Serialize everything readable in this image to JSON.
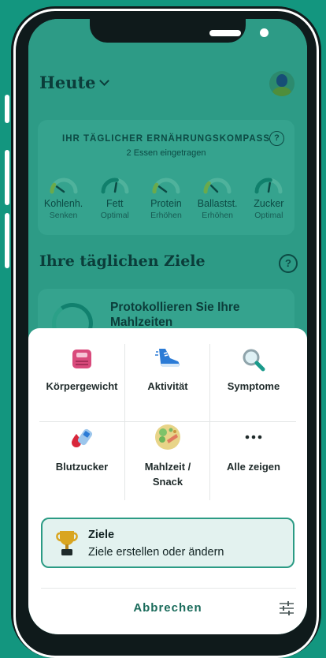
{
  "colors": {
    "accent": "#13967f",
    "dim_bg": "#2d9b86",
    "text_dark": "#0b3d3a"
  },
  "header": {
    "title": "Heute"
  },
  "compass": {
    "title": "IHR TÄGLICHER ERNÄHRUNGSKOMPASS",
    "subtitle": "2 Essen eingetragen",
    "gauges": [
      {
        "name": "Kohlenh.",
        "status": "Senken",
        "level": 0.2
      },
      {
        "name": "Fett",
        "status": "Optimal",
        "level": 0.55
      },
      {
        "name": "Protein",
        "status": "Erhöhen",
        "level": 0.2
      },
      {
        "name": "Ballastst.",
        "status": "Erhöhen",
        "level": 0.25
      },
      {
        "name": "Zucker",
        "status": "Optimal",
        "level": 0.55
      }
    ]
  },
  "goals": {
    "title": "Ihre täglichen Ziele",
    "card_text": "Protokollieren Sie Ihre Mahlzeiten"
  },
  "sheet": {
    "items": [
      {
        "label": "Körpergewicht",
        "icon": "scale-icon"
      },
      {
        "label": "Aktivität",
        "icon": "shoe-icon"
      },
      {
        "label": "Symptome",
        "icon": "magnifier-icon"
      },
      {
        "label": "Blutzucker",
        "icon": "glucose-meter-icon"
      },
      {
        "label": "Mahlzeit / Snack",
        "icon": "meal-plate-icon"
      },
      {
        "label": "Alle zeigen",
        "icon": "more-icon"
      }
    ],
    "ziele": {
      "title": "Ziele",
      "subtitle": "Ziele erstellen oder ändern",
      "icon": "trophy-icon"
    },
    "cancel": "Abbrechen",
    "settings_icon": "sliders-icon"
  }
}
